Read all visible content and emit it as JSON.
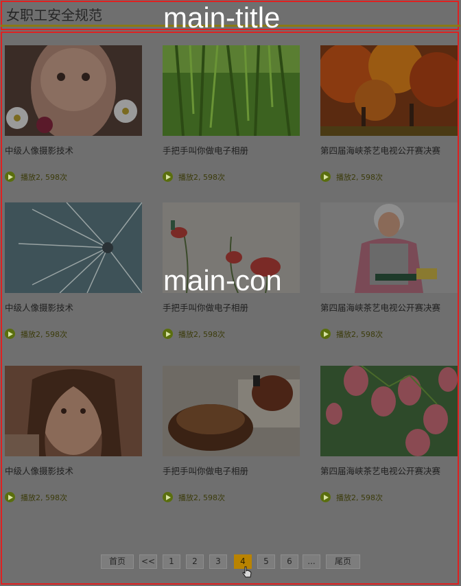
{
  "header": {
    "title": "女职工安全规范"
  },
  "overlays": {
    "title_label": "main-title",
    "content_label": "main-con"
  },
  "cards": [
    {
      "title": "中级人像摄影技术",
      "plays": "播放2, 598次"
    },
    {
      "title": "手把手叫你做电子相册",
      "plays": "播放2, 598次"
    },
    {
      "title": "第四届海峡茶艺电视公开赛决赛",
      "plays": "播放2, 598次"
    },
    {
      "title": "中级人像摄影技术",
      "plays": "播放2, 598次"
    },
    {
      "title": "手把手叫你做电子相册",
      "plays": "播放2, 598次"
    },
    {
      "title": "第四届海峡茶艺电视公开赛决赛",
      "plays": "播放2, 598次"
    },
    {
      "title": "中级人像摄影技术",
      "plays": "播放2, 598次"
    },
    {
      "title": "手把手叫你做电子相册",
      "plays": "播放2, 598次"
    },
    {
      "title": "第四届海峡茶艺电视公开赛决赛",
      "plays": "播放2, 598次"
    }
  ],
  "pagination": {
    "first": "首页",
    "prev": "<<",
    "pages": [
      "1",
      "2",
      "3",
      "4",
      "5",
      "6",
      "..."
    ],
    "current": "4",
    "last": "尾页"
  }
}
